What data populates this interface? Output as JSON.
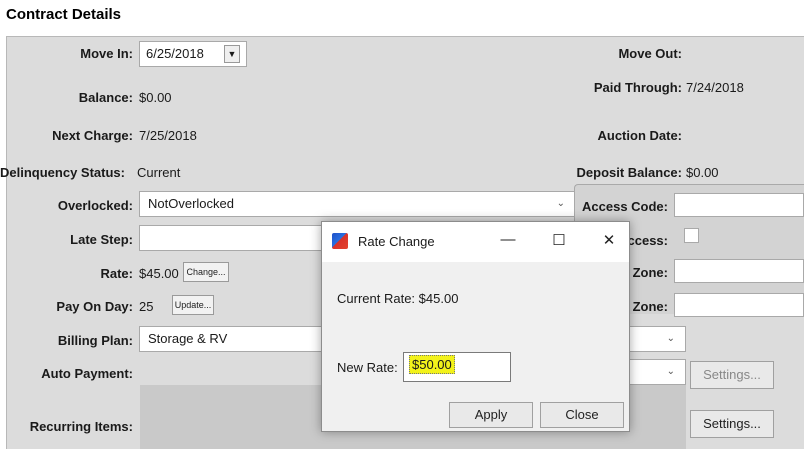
{
  "header": {
    "title": "Contract Details"
  },
  "left": {
    "move_in_label": "Move In:",
    "move_in_value": "6/25/2018",
    "balance_label": "Balance:",
    "balance_value": "$0.00",
    "next_charge_label": "Next Charge:",
    "next_charge_value": "7/25/2018",
    "delinquency_label": "Delinquency Status:",
    "delinquency_value": "Current",
    "overlocked_label": "Overlocked:",
    "overlocked_value": "NotOverlocked",
    "late_step_label": "Late Step:",
    "rate_label": "Rate:",
    "rate_value": "$45.00",
    "rate_button": "Change...",
    "pay_on_day_label": "Pay On Day:",
    "pay_on_day_value": "25",
    "pay_button": "Update...",
    "billing_plan_label": "Billing Plan:",
    "billing_plan_value": "Storage & RV",
    "auto_payment_label": "Auto Payment:",
    "recurring_label": "Recurring Items:"
  },
  "right": {
    "move_out_label": "Move Out:",
    "paid_through_label": "Paid Through:",
    "paid_through_value": "7/24/2018",
    "auction_label": "Auction Date:",
    "deposit_label": "Deposit Balance:",
    "deposit_value": "$0.00",
    "access_code_label": "Access Code:",
    "access_label_partial": "ccess:",
    "zone1_label_partial": "Zone:",
    "zone2_label_partial": "Zone:",
    "settings1_button": "Settings...",
    "settings2_button": "Settings..."
  },
  "dialog": {
    "title": "Rate Change",
    "current_rate_label": "Current Rate:",
    "current_rate_value": "$45.00",
    "new_rate_label": "New Rate:",
    "new_rate_value": "$50.00",
    "apply_button": "Apply",
    "close_button": "Close",
    "minimize_glyph": "—",
    "maximize_glyph": "☐",
    "close_glyph": "✕"
  },
  "icons": {
    "dropdown": "triangle-down",
    "chevron": "chevron-down",
    "app_icon": "rate-change-app-icon"
  }
}
